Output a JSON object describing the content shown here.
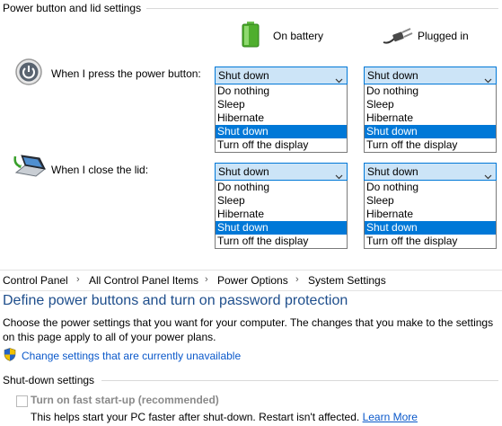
{
  "section": {
    "title": "Power button and lid settings"
  },
  "columns": {
    "battery": "On battery",
    "plugged": "Plugged in"
  },
  "power_button": {
    "label": "When I press the power button:",
    "battery_value": "Shut down",
    "plugged_value": "Shut down"
  },
  "lid": {
    "label": "When I close the lid:",
    "battery_value": "Shut down",
    "plugged_value": "Shut down"
  },
  "options": [
    "Do nothing",
    "Sleep",
    "Hibernate",
    "Shut down",
    "Turn off the display"
  ],
  "breadcrumb": [
    "Control Panel",
    "All Control Panel Items",
    "Power Options",
    "System Settings"
  ],
  "page": {
    "title": "Define power buttons and turn on password protection",
    "description": "Choose the power settings that you want for your computer. The changes that you make to the settings on this page apply to all of your power plans.",
    "change_link": "Change settings that are currently unavailable"
  },
  "shutdown": {
    "title": "Shut-down settings",
    "fast_startup_label": "Turn on fast start-up (recommended)",
    "fast_startup_help": "This helps start your PC faster after shut-down. Restart isn't affected.",
    "learn_more": "Learn More"
  },
  "colors": {
    "accent": "#0078d7",
    "dropdown_bg": "#cce4f7",
    "title_blue": "#1e4e8c",
    "link": "#0a58ca"
  }
}
